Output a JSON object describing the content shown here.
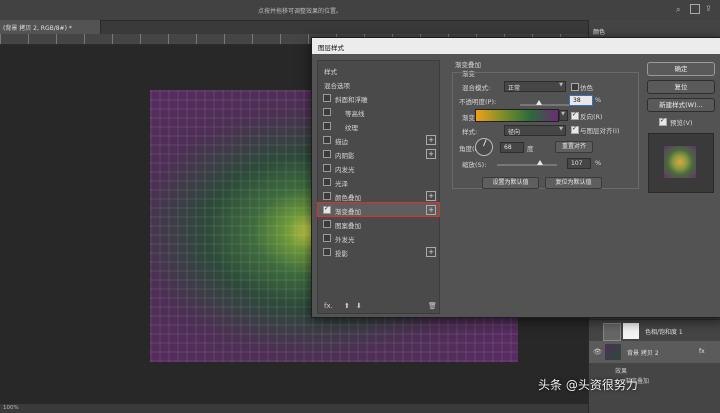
{
  "app": {
    "hint_text": "点按并拖移可调整效果的位置。",
    "doc_tab": "(背景 拷贝 2, RGB/8#) *",
    "zoom": "100%",
    "watermark": "头条 @头资很努力"
  },
  "right_panel": {
    "color_tab": "颜色",
    "layers": [
      {
        "name": "色相/饱和度 1",
        "kind": "adjustment"
      },
      {
        "name": "背景 拷贝 2",
        "kind": "image",
        "fx": "fx"
      }
    ],
    "effects_label": "效果",
    "effect_item": "渐变叠加"
  },
  "dialog": {
    "title": "图层样式",
    "styles_list": [
      {
        "label": "样式",
        "checkbox": false,
        "plus": false,
        "header": true
      },
      {
        "label": "混合选项",
        "checkbox": false,
        "plus": false,
        "header": true
      },
      {
        "label": "斜面和浮雕",
        "checkbox": true,
        "checked": false,
        "plus": false
      },
      {
        "label": "等高线",
        "checkbox": true,
        "checked": false,
        "plus": false,
        "indent": true
      },
      {
        "label": "纹理",
        "checkbox": true,
        "checked": false,
        "plus": false,
        "indent": true
      },
      {
        "label": "描边",
        "checkbox": true,
        "checked": false,
        "plus": true
      },
      {
        "label": "内阴影",
        "checkbox": true,
        "checked": false,
        "plus": true
      },
      {
        "label": "内发光",
        "checkbox": true,
        "checked": false,
        "plus": false
      },
      {
        "label": "光泽",
        "checkbox": true,
        "checked": false,
        "plus": false
      },
      {
        "label": "颜色叠加",
        "checkbox": true,
        "checked": false,
        "plus": true
      },
      {
        "label": "渐变叠加",
        "checkbox": true,
        "checked": true,
        "plus": true,
        "selected": true
      },
      {
        "label": "图案叠加",
        "checkbox": true,
        "checked": false,
        "plus": false
      },
      {
        "label": "外发光",
        "checkbox": true,
        "checked": false,
        "plus": false
      },
      {
        "label": "投影",
        "checkbox": true,
        "checked": false,
        "plus": true
      }
    ],
    "list_footer": {
      "fx": "fx.",
      "up": "⬆",
      "down": "⬇",
      "trash": "🗑"
    },
    "gradient_overlay": {
      "title": "渐变叠加",
      "subtitle": "渐变",
      "blend_mode_label": "混合模式:",
      "blend_mode_value": "正常",
      "dither_label": "仿色",
      "dither_checked": false,
      "opacity_label": "不透明度(P):",
      "opacity_value": "38",
      "opacity_unit": "%",
      "opacity_fraction": 0.38,
      "gradient_label": "渐变:",
      "reverse_label": "反向(R)",
      "reverse_checked": true,
      "style_label": "样式:",
      "style_value": "径向",
      "align_label": "与图层对齐(I)",
      "align_checked": true,
      "angle_label": "角度(N):",
      "angle_value": "68",
      "angle_unit": "度",
      "reset_align_button": "重置对齐",
      "scale_label": "缩放(S):",
      "scale_value": "107",
      "scale_unit": "%",
      "set_default_button": "设置为默认值",
      "reset_default_button": "复位为默认值",
      "gradient_colors": [
        "#f0a116",
        "#7a8e2a",
        "#2d6a3b",
        "#6a2c74"
      ]
    },
    "buttons": {
      "ok": "确定",
      "reset": "复位",
      "new_style": "新建样式(W)...",
      "preview_label": "预览(V)",
      "preview_checked": true
    }
  }
}
